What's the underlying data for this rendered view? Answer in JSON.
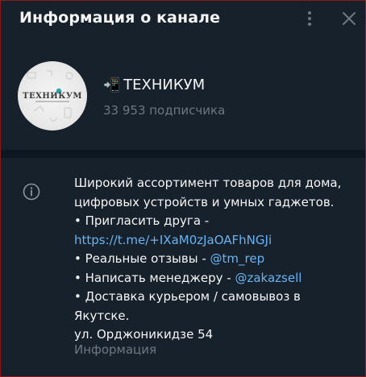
{
  "header": {
    "title": "Информация о канале"
  },
  "channel": {
    "avatar_text": "ТЕХНИКУМ",
    "icon": "📲",
    "name": "ТЕХНИКУМ",
    "subscribers": "33 953 подписчика"
  },
  "info": {
    "line1": "Широкий ассортимент товаров для дома,",
    "line2": "цифровых устройств и умных гаджетов.",
    "line3": "•  Пригласить друга -",
    "invite_link": "https://t.me/+IXaM0zJaOAFhNGJi",
    "line5_prefix": "•  Реальные отзывы - ",
    "reviews_link": "@tm_rep",
    "line6_prefix": "•  Написать менеджеру - ",
    "manager_link": "@zakazsell",
    "line7": "•  Доставка курьером / самовывоз в",
    "line8": "Якутске.",
    "line9": "ул. Орджоникидзе 54",
    "caption": "Информация"
  },
  "colors": {
    "background": "#17212b",
    "divider": "#0e1621",
    "link": "#6ab3f3",
    "muted": "#6d7883",
    "text": "#f5f5f5"
  }
}
